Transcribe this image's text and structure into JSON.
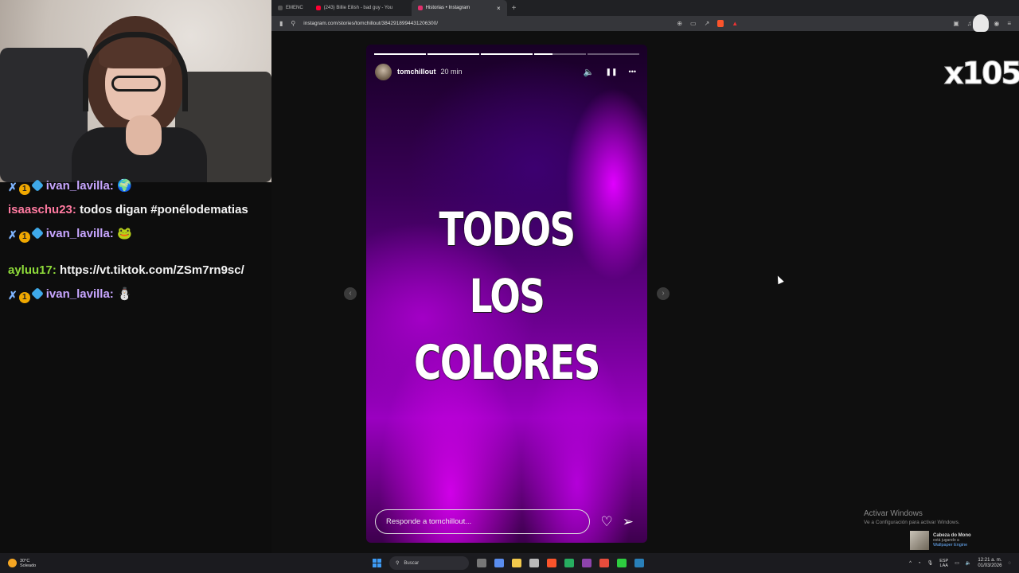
{
  "browser": {
    "tabs": [
      {
        "label": "EMENC",
        "color": "#555555",
        "active": false
      },
      {
        "label": "(243) Billie Eilish - bad guy - You",
        "color": "#ff0033",
        "active": false
      },
      {
        "label": "Historias • Instagram",
        "color": "#e1306c",
        "active": true
      }
    ],
    "tab_close": "×",
    "new_tab": "+",
    "url": "instagram.com/stories/tomchillout/3842918994431206300/"
  },
  "story": {
    "username": "tomchillout",
    "time": "20 min",
    "text_lines": [
      "TODOS",
      "LOS",
      "COLORES"
    ],
    "reply_placeholder": "Responde a tomchillout...",
    "progress": {
      "total": 5,
      "completed": 3,
      "current_fraction": 0.35
    },
    "mute_icon": "🔈",
    "pause_icon": "❚❚",
    "more_icon": "•••",
    "like_icon": "♡",
    "send_icon": "➢",
    "prev_arrow": "‹",
    "next_arrow": "›"
  },
  "chat": {
    "messages": [
      {
        "user": "ivan_lavilla",
        "user_class": "user-ivan",
        "badges": true,
        "text": "🌍"
      },
      {
        "user": "isaaschu23",
        "user_class": "user-isaa",
        "badges": false,
        "text": "todos digan #ponélodematias"
      },
      {
        "user": "ivan_lavilla",
        "user_class": "user-ivan",
        "badges": true,
        "text": "🐸"
      },
      {
        "user": "ayluu17",
        "user_class": "user-aylu",
        "badges": false,
        "text": "https://vt.tiktok.com/ZSm7rn9sc/"
      },
      {
        "user": "ivan_lavilla",
        "user_class": "user-ivan",
        "badges": true,
        "text": "⛄"
      }
    ],
    "badge_sword": "✗",
    "badge_coin": "1"
  },
  "overlay": {
    "counter": "x105"
  },
  "windows": {
    "activate_title": "Activar Windows",
    "activate_sub": "Ve a Configuración para activar Windows.",
    "notif_title": "Cabeza do Mono",
    "notif_line2": "está jugando a",
    "notif_line3": "Wallpaper Engine"
  },
  "taskbar": {
    "temp": "30°C",
    "weather": "Soleado",
    "search_placeholder": "Buscar",
    "lang_top": "ESP",
    "lang_bottom": "LAA",
    "time": "12:21 a. m.",
    "date": "01/03/2026",
    "tray_chevron": "^"
  },
  "colors": {
    "accent": "#3d9bf5",
    "story_purple": "#9a00c0"
  }
}
